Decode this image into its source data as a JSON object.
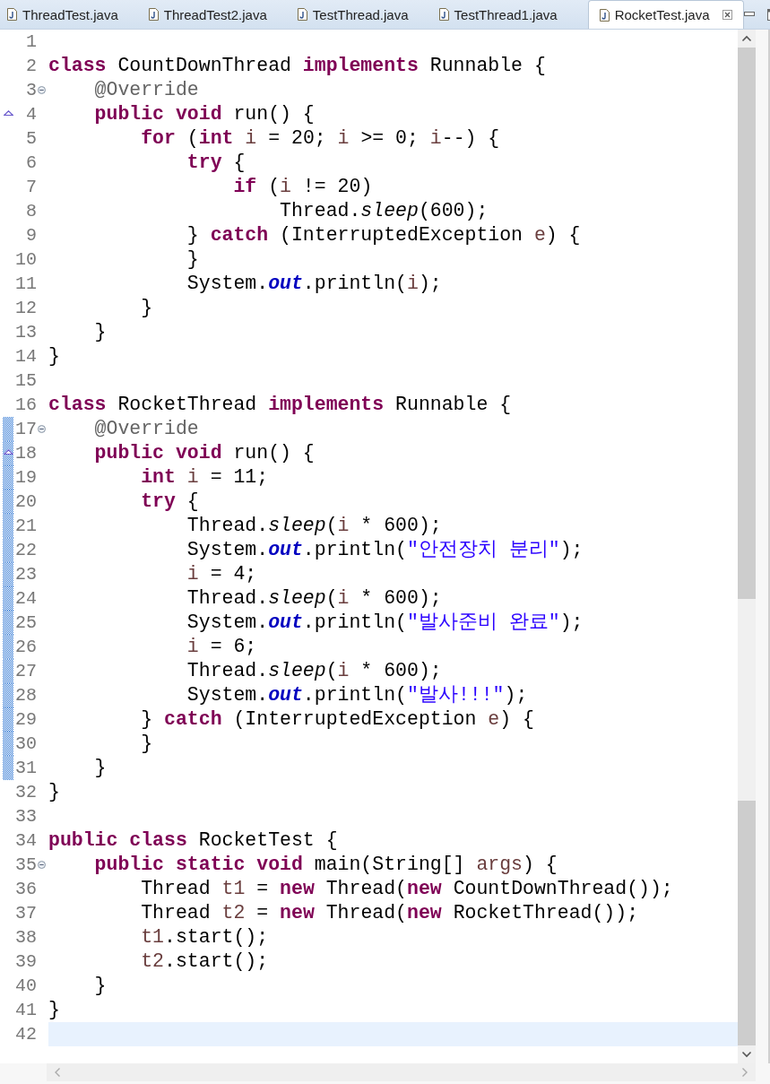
{
  "tabs": [
    {
      "label": "ThreadTest.java",
      "selected": false
    },
    {
      "label": "ThreadTest2.java",
      "selected": false
    },
    {
      "label": "TestThread.java",
      "selected": false
    },
    {
      "label": "TestThread1.java",
      "selected": false
    },
    {
      "label": "RocketTest.java",
      "selected": true
    }
  ],
  "lines": [
    {
      "num": "1",
      "fold": false,
      "override": false,
      "in_range": false,
      "current": false
    },
    {
      "num": "2",
      "fold": false,
      "override": false,
      "in_range": false,
      "current": false,
      "tokens": [
        {
          "text": "class",
          "kind": "keyword"
        },
        {
          "text": " CountDownThread ",
          "kind": "plain"
        },
        {
          "text": "implements",
          "kind": "keyword"
        },
        {
          "text": " Runnable {",
          "kind": "plain"
        }
      ]
    },
    {
      "num": "3",
      "fold": true,
      "override": false,
      "in_range": false,
      "current": false,
      "tokens": [
        {
          "text": "    @Override",
          "kind": "annotation"
        }
      ]
    },
    {
      "num": "4",
      "fold": false,
      "override": true,
      "in_range": false,
      "current": false,
      "tokens": [
        {
          "text": "    public void",
          "kind": "keyword"
        },
        {
          "text": " run() {",
          "kind": "plain"
        }
      ]
    },
    {
      "num": "5",
      "fold": false,
      "override": false,
      "in_range": false,
      "current": false,
      "tokens": [
        {
          "text": "        for",
          "kind": "keyword"
        },
        {
          "text": " (",
          "kind": "plain"
        },
        {
          "text": "int",
          "kind": "keyword"
        },
        {
          "text": " i",
          "kind": "local"
        },
        {
          "text": " = 20; ",
          "kind": "plain"
        },
        {
          "text": "i",
          "kind": "local"
        },
        {
          "text": " >= 0; ",
          "kind": "plain"
        },
        {
          "text": "i",
          "kind": "local"
        },
        {
          "text": "--) {",
          "kind": "plain"
        }
      ]
    },
    {
      "num": "6",
      "fold": false,
      "override": false,
      "in_range": false,
      "current": false,
      "tokens": [
        {
          "text": "            try",
          "kind": "keyword"
        },
        {
          "text": " {",
          "kind": "plain"
        }
      ]
    },
    {
      "num": "7",
      "fold": false,
      "override": false,
      "in_range": false,
      "current": false,
      "tokens": [
        {
          "text": "                if",
          "kind": "keyword"
        },
        {
          "text": " (",
          "kind": "plain"
        },
        {
          "text": "i",
          "kind": "local"
        },
        {
          "text": " != 20)",
          "kind": "plain"
        }
      ]
    },
    {
      "num": "8",
      "fold": false,
      "override": false,
      "in_range": false,
      "current": false,
      "tokens": [
        {
          "text": "                    Thread.",
          "kind": "plain"
        },
        {
          "text": "sleep",
          "kind": "static"
        },
        {
          "text": "(600);",
          "kind": "plain"
        }
      ]
    },
    {
      "num": "9",
      "fold": false,
      "override": false,
      "in_range": false,
      "current": false,
      "tokens": [
        {
          "text": "            } ",
          "kind": "plain"
        },
        {
          "text": "catch",
          "kind": "keyword"
        },
        {
          "text": " (InterruptedException ",
          "kind": "plain"
        },
        {
          "text": "e",
          "kind": "local"
        },
        {
          "text": ") {",
          "kind": "plain"
        }
      ]
    },
    {
      "num": "10",
      "fold": false,
      "override": false,
      "in_range": false,
      "current": false,
      "tokens": [
        {
          "text": "            }",
          "kind": "plain"
        }
      ]
    },
    {
      "num": "11",
      "fold": false,
      "override": false,
      "in_range": false,
      "current": false,
      "tokens": [
        {
          "text": "            System.",
          "kind": "plain"
        },
        {
          "text": "out",
          "kind": "field"
        },
        {
          "text": ".println(",
          "kind": "plain"
        },
        {
          "text": "i",
          "kind": "local"
        },
        {
          "text": ");",
          "kind": "plain"
        }
      ]
    },
    {
      "num": "12",
      "fold": false,
      "override": false,
      "in_range": false,
      "current": false,
      "tokens": [
        {
          "text": "        }",
          "kind": "plain"
        }
      ]
    },
    {
      "num": "13",
      "fold": false,
      "override": false,
      "in_range": false,
      "current": false,
      "tokens": [
        {
          "text": "    }",
          "kind": "plain"
        }
      ]
    },
    {
      "num": "14",
      "fold": false,
      "override": false,
      "in_range": false,
      "current": false,
      "tokens": [
        {
          "text": "}",
          "kind": "plain"
        }
      ]
    },
    {
      "num": "15",
      "fold": false,
      "override": false,
      "in_range": false,
      "current": false
    },
    {
      "num": "16",
      "fold": false,
      "override": false,
      "in_range": false,
      "current": false,
      "tokens": [
        {
          "text": "class",
          "kind": "keyword"
        },
        {
          "text": " RocketThread ",
          "kind": "plain"
        },
        {
          "text": "implements",
          "kind": "keyword"
        },
        {
          "text": " Runnable {",
          "kind": "plain"
        }
      ]
    },
    {
      "num": "17",
      "fold": true,
      "override": false,
      "in_range": true,
      "current": false,
      "tokens": [
        {
          "text": "    @Override",
          "kind": "annotation"
        }
      ]
    },
    {
      "num": "18",
      "fold": false,
      "override": true,
      "in_range": true,
      "current": false,
      "tokens": [
        {
          "text": "    public void",
          "kind": "keyword"
        },
        {
          "text": " run() {",
          "kind": "plain"
        }
      ]
    },
    {
      "num": "19",
      "fold": false,
      "override": false,
      "in_range": true,
      "current": false,
      "tokens": [
        {
          "text": "        int",
          "kind": "keyword"
        },
        {
          "text": " i",
          "kind": "local"
        },
        {
          "text": " = 11;",
          "kind": "plain"
        }
      ]
    },
    {
      "num": "20",
      "fold": false,
      "override": false,
      "in_range": true,
      "current": false,
      "tokens": [
        {
          "text": "        try",
          "kind": "keyword"
        },
        {
          "text": " {",
          "kind": "plain"
        }
      ]
    },
    {
      "num": "21",
      "fold": false,
      "override": false,
      "in_range": true,
      "current": false,
      "tokens": [
        {
          "text": "            Thread.",
          "kind": "plain"
        },
        {
          "text": "sleep",
          "kind": "static"
        },
        {
          "text": "(",
          "kind": "plain"
        },
        {
          "text": "i",
          "kind": "local"
        },
        {
          "text": " * 600);",
          "kind": "plain"
        }
      ]
    },
    {
      "num": "22",
      "fold": false,
      "override": false,
      "in_range": true,
      "current": false,
      "tokens": [
        {
          "text": "            System.",
          "kind": "plain"
        },
        {
          "text": "out",
          "kind": "field"
        },
        {
          "text": ".println(",
          "kind": "plain"
        },
        {
          "text": "\"안전장치 분리\"",
          "kind": "string"
        },
        {
          "text": ");",
          "kind": "plain"
        }
      ]
    },
    {
      "num": "23",
      "fold": false,
      "override": false,
      "in_range": true,
      "current": false,
      "tokens": [
        {
          "text": "            i",
          "kind": "local"
        },
        {
          "text": " = 4;",
          "kind": "plain"
        }
      ]
    },
    {
      "num": "24",
      "fold": false,
      "override": false,
      "in_range": true,
      "current": false,
      "tokens": [
        {
          "text": "            Thread.",
          "kind": "plain"
        },
        {
          "text": "sleep",
          "kind": "static"
        },
        {
          "text": "(",
          "kind": "plain"
        },
        {
          "text": "i",
          "kind": "local"
        },
        {
          "text": " * 600);",
          "kind": "plain"
        }
      ]
    },
    {
      "num": "25",
      "fold": false,
      "override": false,
      "in_range": true,
      "current": false,
      "tokens": [
        {
          "text": "            System.",
          "kind": "plain"
        },
        {
          "text": "out",
          "kind": "field"
        },
        {
          "text": ".println(",
          "kind": "plain"
        },
        {
          "text": "\"발사준비 완료\"",
          "kind": "string"
        },
        {
          "text": ");",
          "kind": "plain"
        }
      ]
    },
    {
      "num": "26",
      "fold": false,
      "override": false,
      "in_range": true,
      "current": false,
      "tokens": [
        {
          "text": "            i",
          "kind": "local"
        },
        {
          "text": " = 6;",
          "kind": "plain"
        }
      ]
    },
    {
      "num": "27",
      "fold": false,
      "override": false,
      "in_range": true,
      "current": false,
      "tokens": [
        {
          "text": "            Thread.",
          "kind": "plain"
        },
        {
          "text": "sleep",
          "kind": "static"
        },
        {
          "text": "(",
          "kind": "plain"
        },
        {
          "text": "i",
          "kind": "local"
        },
        {
          "text": " * 600);",
          "kind": "plain"
        }
      ]
    },
    {
      "num": "28",
      "fold": false,
      "override": false,
      "in_range": true,
      "current": false,
      "tokens": [
        {
          "text": "            System.",
          "kind": "plain"
        },
        {
          "text": "out",
          "kind": "field"
        },
        {
          "text": ".println(",
          "kind": "plain"
        },
        {
          "text": "\"발사!!!\"",
          "kind": "string"
        },
        {
          "text": ");",
          "kind": "plain"
        }
      ]
    },
    {
      "num": "29",
      "fold": false,
      "override": false,
      "in_range": true,
      "current": false,
      "tokens": [
        {
          "text": "        } ",
          "kind": "plain"
        },
        {
          "text": "catch",
          "kind": "keyword"
        },
        {
          "text": " (InterruptedException ",
          "kind": "plain"
        },
        {
          "text": "e",
          "kind": "local"
        },
        {
          "text": ") {",
          "kind": "plain"
        }
      ]
    },
    {
      "num": "30",
      "fold": false,
      "override": false,
      "in_range": true,
      "current": false,
      "tokens": [
        {
          "text": "        }",
          "kind": "plain"
        }
      ]
    },
    {
      "num": "31",
      "fold": false,
      "override": false,
      "in_range": true,
      "current": false,
      "tokens": [
        {
          "text": "    }",
          "kind": "plain"
        }
      ]
    },
    {
      "num": "32",
      "fold": false,
      "override": false,
      "in_range": false,
      "current": false,
      "tokens": [
        {
          "text": "}",
          "kind": "plain"
        }
      ]
    },
    {
      "num": "33",
      "fold": false,
      "override": false,
      "in_range": false,
      "current": false
    },
    {
      "num": "34",
      "fold": false,
      "override": false,
      "in_range": false,
      "current": false,
      "tokens": [
        {
          "text": "public class",
          "kind": "keyword"
        },
        {
          "text": " RocketTest {",
          "kind": "plain"
        }
      ]
    },
    {
      "num": "35",
      "fold": true,
      "override": false,
      "in_range": false,
      "current": false,
      "tokens": [
        {
          "text": "    public static void",
          "kind": "keyword"
        },
        {
          "text": " main(String[] ",
          "kind": "plain"
        },
        {
          "text": "args",
          "kind": "local"
        },
        {
          "text": ") {",
          "kind": "plain"
        }
      ]
    },
    {
      "num": "36",
      "fold": false,
      "override": false,
      "in_range": false,
      "current": false,
      "tokens": [
        {
          "text": "        Thread ",
          "kind": "plain"
        },
        {
          "text": "t1",
          "kind": "local"
        },
        {
          "text": " = ",
          "kind": "plain"
        },
        {
          "text": "new",
          "kind": "keyword"
        },
        {
          "text": " Thread(",
          "kind": "plain"
        },
        {
          "text": "new",
          "kind": "keyword"
        },
        {
          "text": " CountDownThread());",
          "kind": "plain"
        }
      ]
    },
    {
      "num": "37",
      "fold": false,
      "override": false,
      "in_range": false,
      "current": false,
      "tokens": [
        {
          "text": "        Thread ",
          "kind": "plain"
        },
        {
          "text": "t2",
          "kind": "local"
        },
        {
          "text": " = ",
          "kind": "plain"
        },
        {
          "text": "new",
          "kind": "keyword"
        },
        {
          "text": " Thread(",
          "kind": "plain"
        },
        {
          "text": "new",
          "kind": "keyword"
        },
        {
          "text": " RocketThread());",
          "kind": "plain"
        }
      ]
    },
    {
      "num": "38",
      "fold": false,
      "override": false,
      "in_range": false,
      "current": false,
      "tokens": [
        {
          "text": "        t1",
          "kind": "local"
        },
        {
          "text": ".start();",
          "kind": "plain"
        }
      ]
    },
    {
      "num": "39",
      "fold": false,
      "override": false,
      "in_range": false,
      "current": false,
      "tokens": [
        {
          "text": "        t2",
          "kind": "local"
        },
        {
          "text": ".start();",
          "kind": "plain"
        }
      ]
    },
    {
      "num": "40",
      "fold": false,
      "override": false,
      "in_range": false,
      "current": false,
      "tokens": [
        {
          "text": "    }",
          "kind": "plain"
        }
      ]
    },
    {
      "num": "41",
      "fold": false,
      "override": false,
      "in_range": false,
      "current": false,
      "tokens": [
        {
          "text": "}",
          "kind": "plain"
        }
      ]
    },
    {
      "num": "42",
      "fold": false,
      "override": false,
      "in_range": false,
      "current": true
    }
  ]
}
